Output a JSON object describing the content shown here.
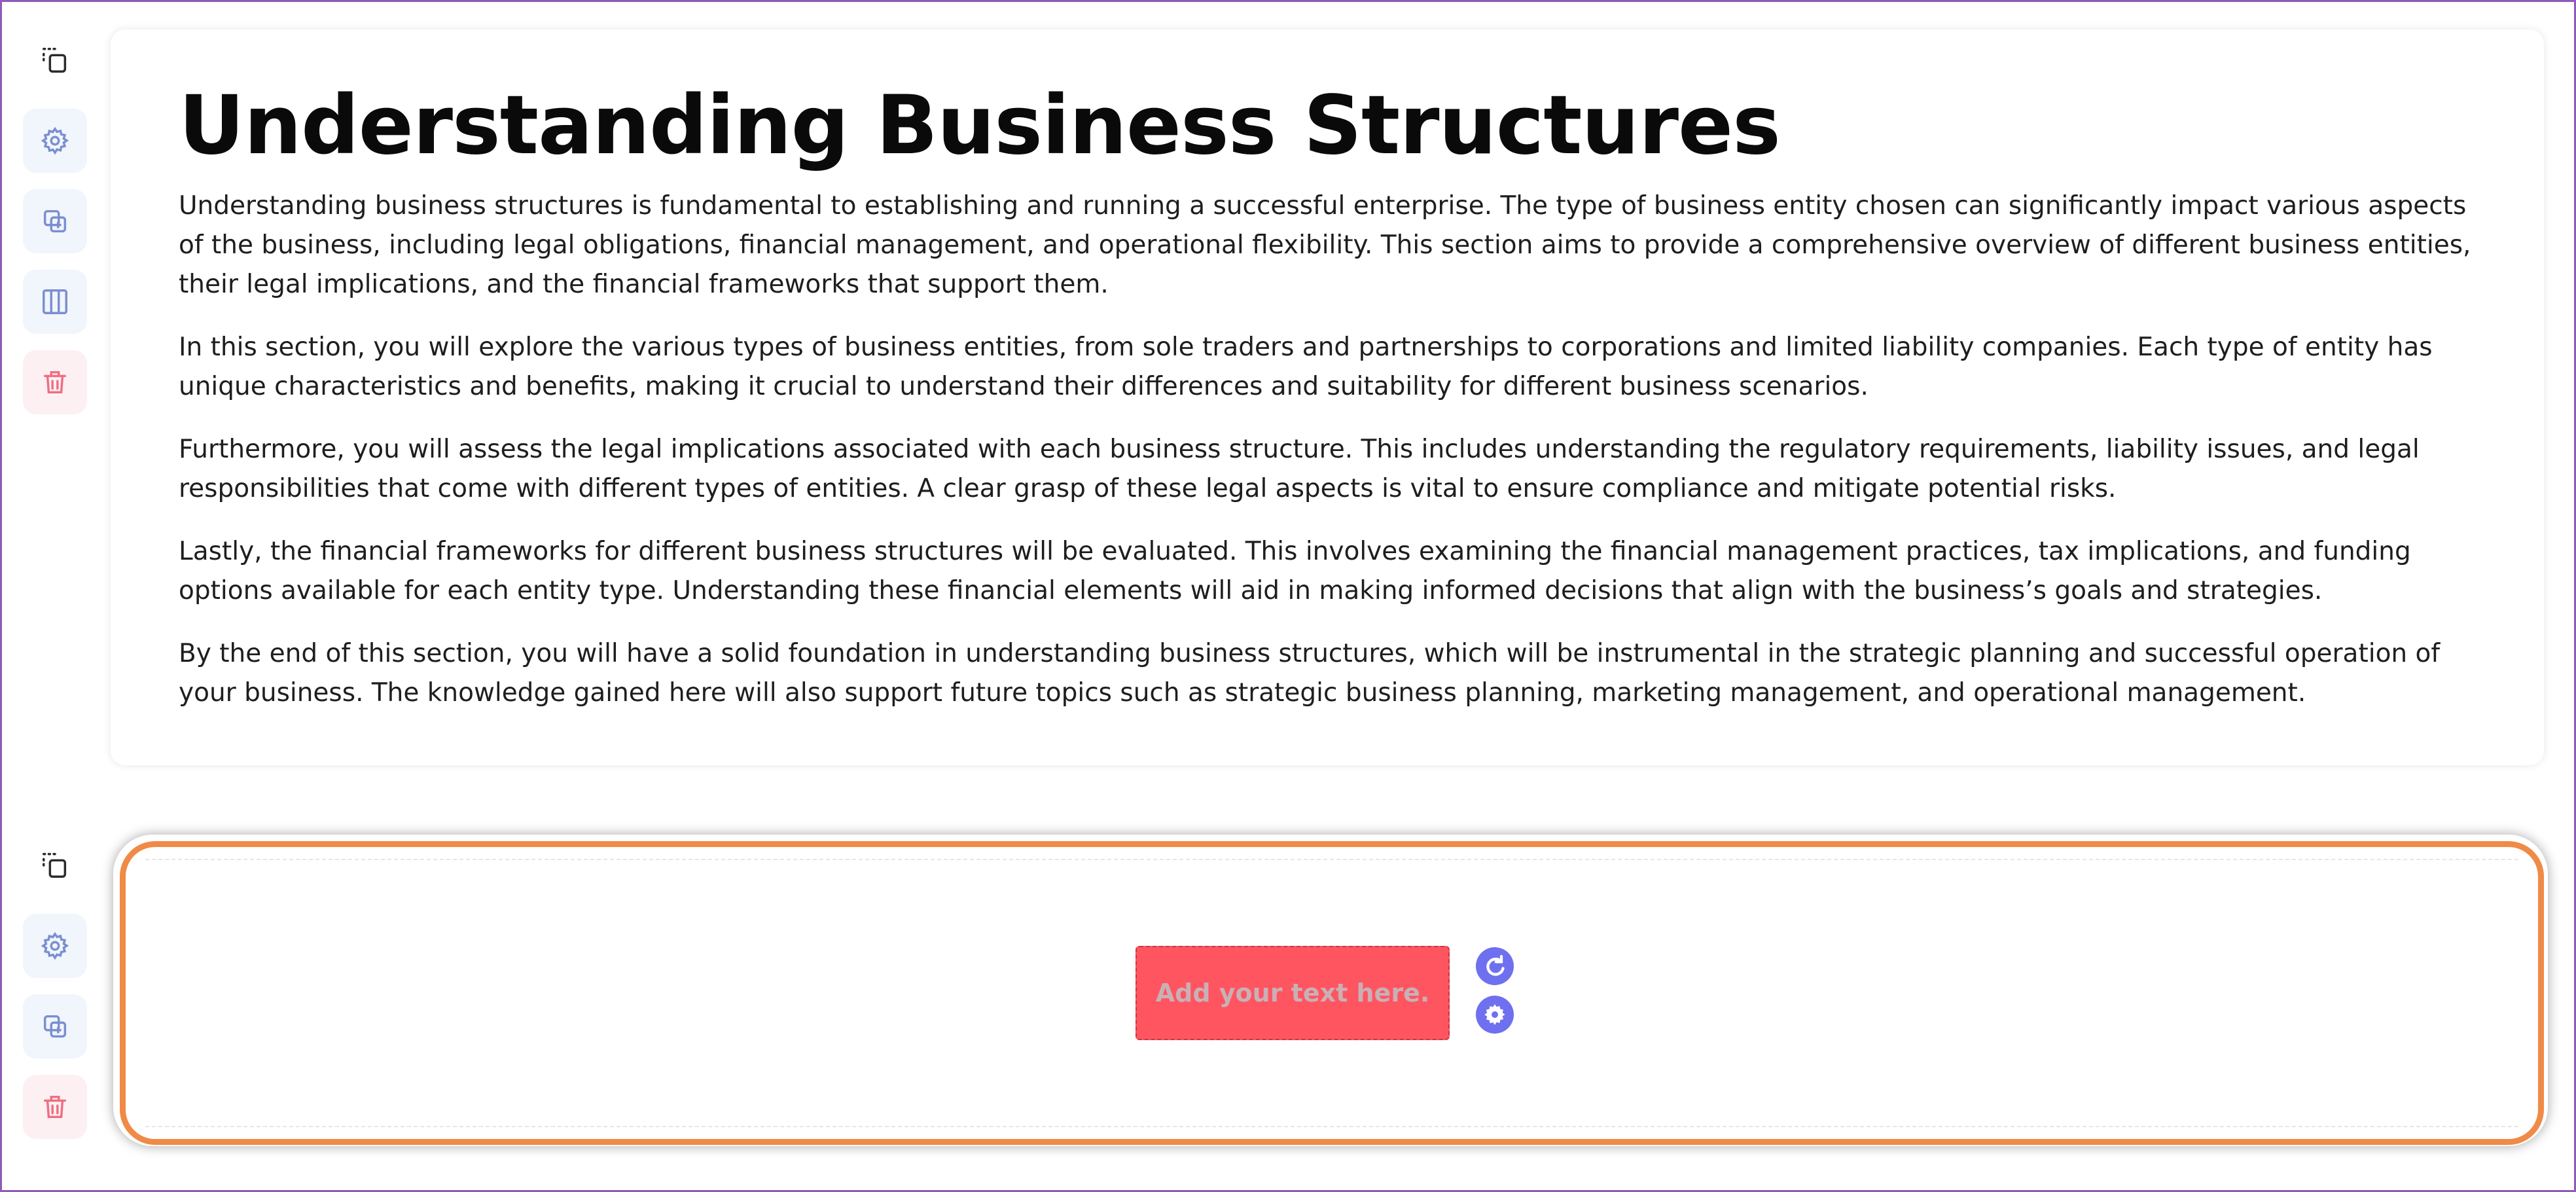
{
  "content_block": {
    "title": "Understanding Business Structures",
    "paragraphs": [
      "Understanding business structures is fundamental to establishing and running a successful enterprise. The type of business entity chosen can significantly impact various aspects of the business, including legal obligations, financial management, and operational flexibility. This section aims to provide a comprehensive overview of different business entities, their legal implications, and the financial frameworks that support them.",
      "In this section, you will explore the various types of business entities, from sole traders and partnerships to corporations and limited liability companies. Each type of entity has unique characteristics and benefits, making it crucial to understand their differences and suitability for different business scenarios.",
      "Furthermore, you will assess the legal implications associated with each business structure. This includes understanding the regulatory requirements, liability issues, and legal responsibilities that come with different types of entities. A clear grasp of these legal aspects is vital to ensure compliance and mitigate potential risks.",
      "Lastly, the financial frameworks for different business structures will be evaluated. This involves examining the financial management practices, tax implications, and funding options available for each entity type. Understanding these financial elements will aid in making informed decisions that align with the business’s goals and strategies.",
      "By the end of this section, you will have a solid foundation in understanding business structures, which will be instrumental in the strategic planning and successful operation of your business. The knowledge gained here will also support future topics such as strategic business planning, marketing management, and operational management."
    ]
  },
  "editor_block": {
    "add_text_label": "Add your text here."
  },
  "colors": {
    "accent_orange": "#f08a47",
    "add_text_red": "#ff5561",
    "action_purple": "#6e70f0",
    "toolbar_icon_blue": "#7a8fd0",
    "toolbar_icon_red": "#f06e82"
  },
  "toolbar_top": {
    "icons": [
      "select-block-icon",
      "settings-icon",
      "duplicate-icon",
      "columns-icon",
      "delete-icon"
    ]
  },
  "toolbar_bottom": {
    "icons": [
      "select-block-icon",
      "settings-icon",
      "duplicate-icon",
      "delete-icon"
    ]
  }
}
